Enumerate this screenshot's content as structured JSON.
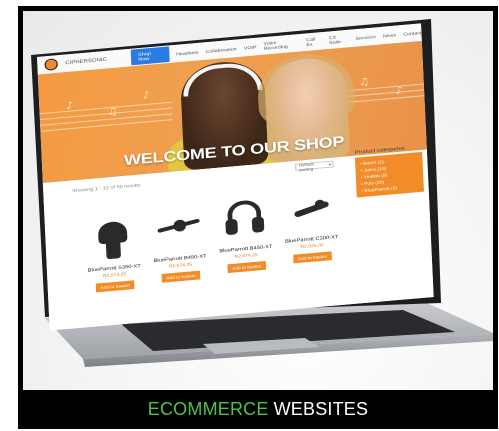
{
  "site": {
    "logo_text": "CIPHERSONIC",
    "nav": {
      "shop_button": "Shop Now",
      "items": [
        "Headsets",
        "Collaboration",
        "VOIP",
        "Voice Recording",
        "Call Ex",
        "CX Suite",
        "Services",
        "News",
        "Contact"
      ]
    },
    "hero_title": "WELCOME TO OUR SHOP",
    "showing_text": "Showing 1 - 12 of 50 results",
    "sort_label": "Default sorting",
    "categories": {
      "title": "Product categories",
      "items": [
        "Boom (1)",
        "Jabra (15)",
        "Yealink (8)",
        "Poly (20)",
        "BlueParrott (5)"
      ]
    },
    "products": [
      {
        "name": "BlueParrott S350-XT",
        "price": "R2,574.25",
        "button": "Add to basket"
      },
      {
        "name": "BlueParrott B450-XT",
        "price": "R2,574.25",
        "button": "Add to basket"
      },
      {
        "name": "BlueParrott B450-XT",
        "price": "R2,574.25",
        "button": "Add to basket"
      },
      {
        "name": "BlueParrott C300-XT",
        "price": "R2,025.00",
        "button": "Add to basket"
      }
    ]
  },
  "caption": {
    "accent": "ECOMMERCE",
    "rest": "WEBSITES",
    "accent_color": "#4fc24a"
  }
}
